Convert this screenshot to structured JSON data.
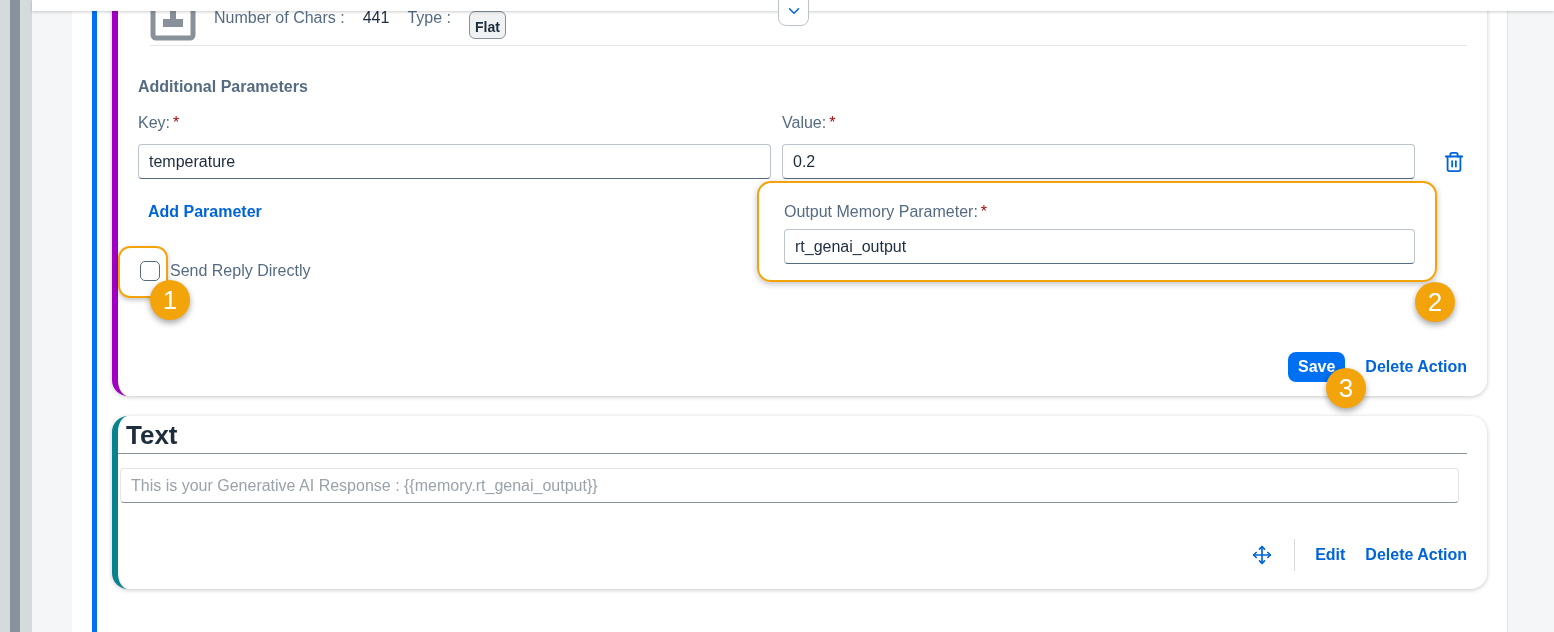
{
  "info": {
    "chars_label": "Number of Chars :",
    "chars_value": "441",
    "type_label": "Type :",
    "type_badge": "Flat"
  },
  "additional": {
    "title": "Additional Parameters",
    "key_label": "Key:",
    "value_label": "Value:",
    "required_mark": "*",
    "params": [
      {
        "key": "temperature",
        "value": "0.2"
      }
    ],
    "add_link": "Add Parameter"
  },
  "send_reply": {
    "label": "Send Reply Directly",
    "checked": false
  },
  "output": {
    "label": "Output Memory Parameter:",
    "required_mark": "*",
    "value": "rt_genai_output"
  },
  "action_buttons": [
    {
      "kind": "primary",
      "label": "Save"
    },
    {
      "kind": "link",
      "label": "Delete Action"
    }
  ],
  "callouts": [
    "1",
    "2",
    "3"
  ],
  "text_card": {
    "title": "Text",
    "placeholder": "This is your Generative AI Response : {{memory.rt_genai_output}}",
    "buttons": [
      {
        "kind": "move"
      },
      {
        "kind": "link",
        "label": "Edit"
      },
      {
        "kind": "link",
        "label": "Delete Action"
      }
    ]
  }
}
